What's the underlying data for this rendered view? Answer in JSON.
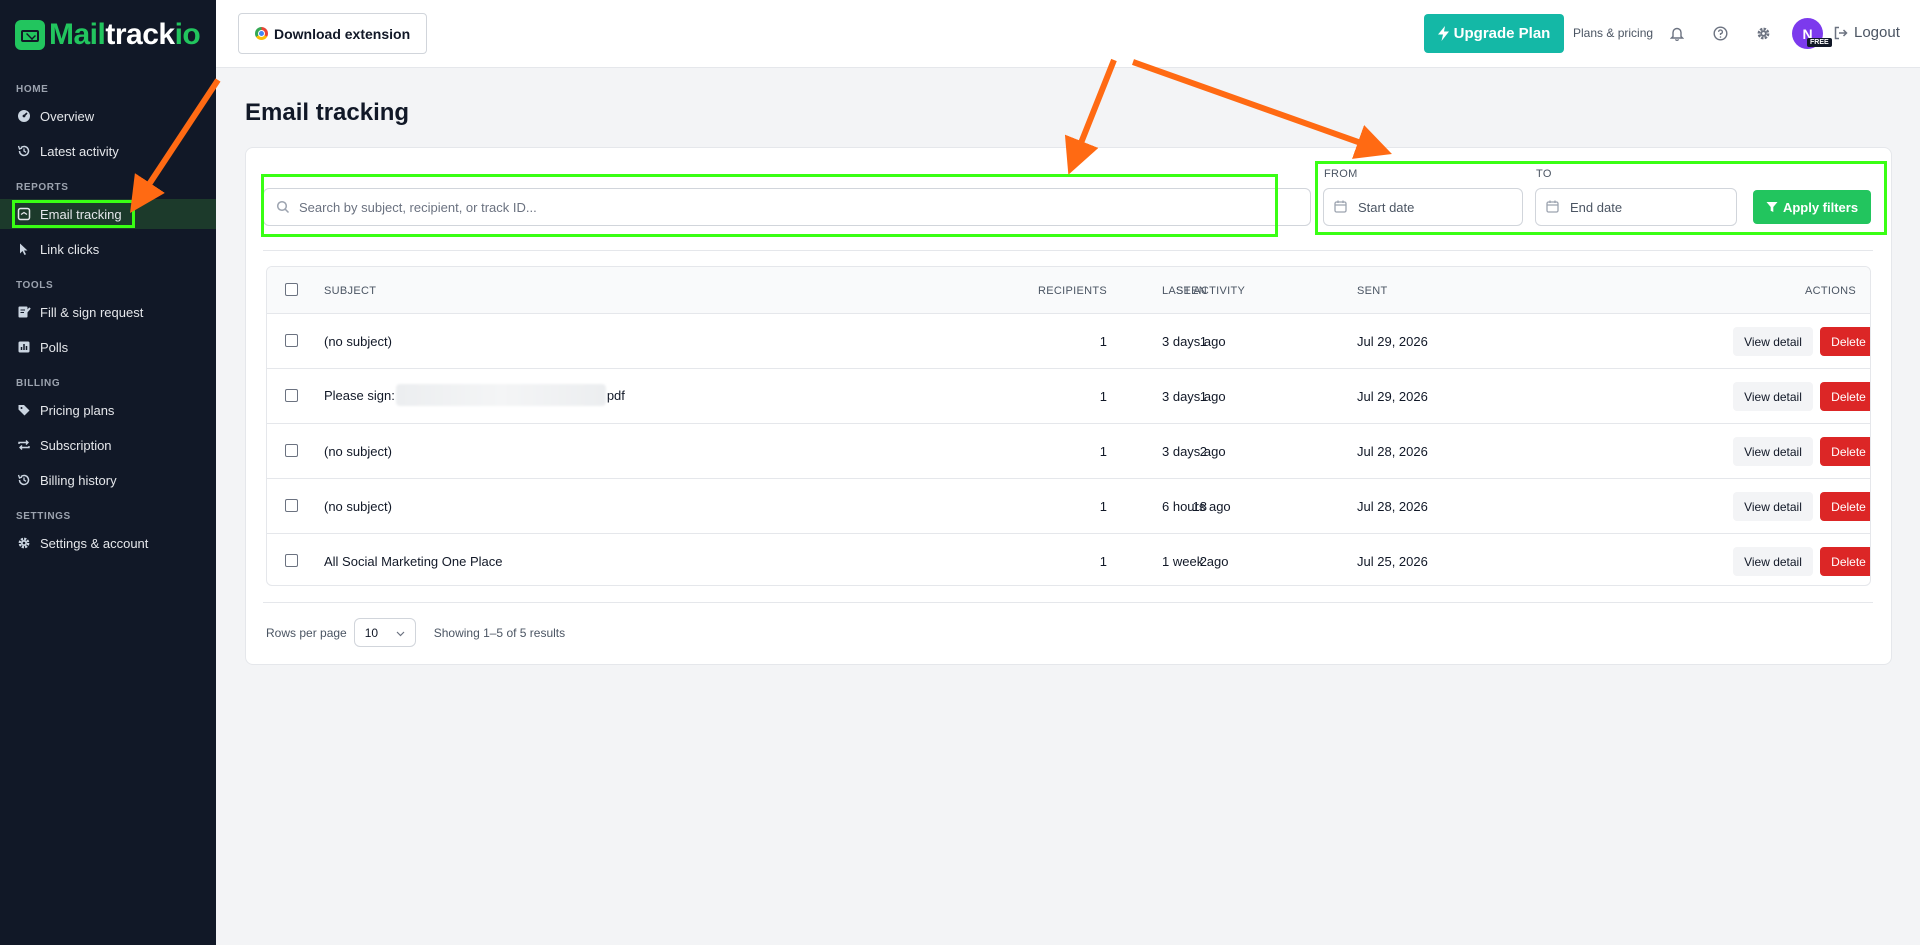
{
  "brand": {
    "part1": "Mail",
    "part2": "track",
    "part3": "io"
  },
  "sidebar": {
    "sections": [
      {
        "label": "HOME",
        "items": [
          {
            "label": "Overview",
            "icon": "dashboard-icon"
          },
          {
            "label": "Latest activity",
            "icon": "history-icon"
          }
        ]
      },
      {
        "label": "REPORTS",
        "items": [
          {
            "label": "Email tracking",
            "icon": "email-tracking-icon",
            "active": true
          },
          {
            "label": "Link clicks",
            "icon": "pointer-icon"
          }
        ]
      },
      {
        "label": "TOOLS",
        "items": [
          {
            "label": "Fill & sign request",
            "icon": "sign-icon"
          },
          {
            "label": "Polls",
            "icon": "poll-icon"
          }
        ]
      },
      {
        "label": "BILLING",
        "items": [
          {
            "label": "Pricing plans",
            "icon": "tags-icon"
          },
          {
            "label": "Subscription",
            "icon": "repeat-icon"
          },
          {
            "label": "Billing history",
            "icon": "history-icon"
          }
        ]
      },
      {
        "label": "SETTINGS",
        "items": [
          {
            "label": "Settings & account",
            "icon": "gear-icon"
          }
        ]
      }
    ]
  },
  "header": {
    "download_label": "Download extension",
    "upgrade_label": "Upgrade Plan",
    "plans_label": "Plans & pricing",
    "avatar_initial": "N",
    "badge": "FREE",
    "logout_label": "Logout"
  },
  "main": {
    "title": "Email tracking",
    "search_placeholder": "Search by subject, recipient, or track ID...",
    "from_label": "FROM",
    "to_label": "TO",
    "start_placeholder": "Start date",
    "end_placeholder": "End date",
    "apply_label": "Apply filters"
  },
  "table": {
    "headers": {
      "subject": "SUBJECT",
      "recipients": "RECIPIENTS",
      "seen": "SEEN",
      "last_activity": "LAST ACTIVITY",
      "sent": "SENT",
      "actions": "ACTIONS"
    },
    "rows": [
      {
        "subject": "(no subject)",
        "recipients": "1",
        "seen": "1",
        "last_activity": "3 days ago",
        "sent": "Jul 29, 2026"
      },
      {
        "subject_prefix": "Please sign:",
        "subject_suffix": "pdf",
        "recipients": "1",
        "seen": "1",
        "last_activity": "3 days ago",
        "sent": "Jul 29, 2026"
      },
      {
        "subject": "(no subject)",
        "recipients": "1",
        "seen": "2",
        "last_activity": "3 days ago",
        "sent": "Jul 28, 2026"
      },
      {
        "subject": "(no subject)",
        "recipients": "1",
        "seen": "18",
        "last_activity": "6 hours ago",
        "sent": "Jul 28, 2026"
      },
      {
        "subject": "All Social Marketing One Place",
        "recipients": "1",
        "seen": "2",
        "last_activity": "1 week ago",
        "sent": "Jul 25, 2026"
      }
    ],
    "view_label": "View detail",
    "delete_label": "Delete"
  },
  "pager": {
    "rows_label": "Rows per page",
    "rows_value": "10",
    "showing": "Showing 1–5 of 5 results"
  },
  "colors": {
    "sidebar_bg": "#111827",
    "brand_green": "#22c55e",
    "upgrade_teal": "#14b8a6",
    "delete_red": "#dc2626",
    "highlight": "#39ff14",
    "arrow": "#ff6a13"
  }
}
